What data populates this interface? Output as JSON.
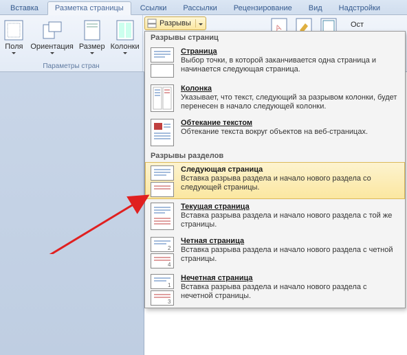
{
  "tabs": {
    "insert": "Вставка",
    "page_layout": "Разметка страницы",
    "references": "Ссылки",
    "mailings": "Рассылки",
    "review": "Рецензирование",
    "view": "Вид",
    "addins": "Надстройки"
  },
  "ribbon": {
    "margins": "Поля",
    "orientation": "Ориентация",
    "size": "Размер",
    "columns": "Колонки",
    "group_label": "Параметры стран",
    "ost": "Ост"
  },
  "breaks_button": "Разрывы",
  "panel": {
    "section1": "Разрывы страниц",
    "section2": "Разрывы разделов",
    "items": {
      "page": {
        "title": "Страница",
        "desc": "Выбор точки, в которой заканчивается одна страница и начинается следующая страница."
      },
      "column": {
        "title": "Колонка",
        "desc": "Указывает, что текст, следующий за разрывом колонки, будет перенесен в начало следующей колонки."
      },
      "textwrap": {
        "title": "Обтекание текстом",
        "desc": "Обтекание текста вокруг объектов на веб-страницах."
      },
      "nextpage": {
        "title": "Следующая страница",
        "desc": "Вставка разрыва раздела и начало нового раздела со следующей страницы."
      },
      "continuous": {
        "title": "Текущая страница",
        "desc": "Вставка разрыва раздела и начало нового раздела с той же страницы."
      },
      "evenpage": {
        "title": "Четная страница",
        "desc": "Вставка разрыва раздела и начало нового раздела с четной страницы."
      },
      "oddpage": {
        "title": "Нечетная страница",
        "desc": "Вставка разрыва раздела и начало нового раздела с нечетной страницы."
      }
    }
  }
}
